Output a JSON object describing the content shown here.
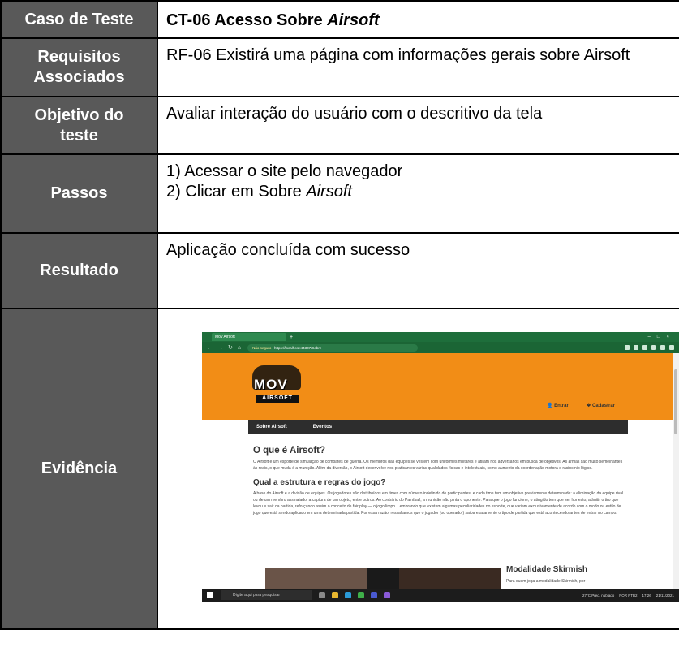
{
  "table": {
    "rows": {
      "caso": {
        "label": "Caso de Teste",
        "value_prefix": "CT-06 Acesso Sobre ",
        "value_italic": "Airsoft"
      },
      "requisitos": {
        "label_line1": "Requisitos",
        "label_line2": "Associados",
        "value": "RF-06 Existirá uma página com informações gerais sobre Airsoft"
      },
      "objetivo": {
        "label_line1": "Objetivo do",
        "label_line2": "teste",
        "value": "Avaliar interação do usuário com o descritivo da tela"
      },
      "passos": {
        "label": "Passos",
        "step1": "1) Acessar o site pelo navegador",
        "step2_prefix": "2) Clicar em Sobre ",
        "step2_italic": "Airsoft"
      },
      "resultado": {
        "label": "Resultado",
        "value": "Aplicação concluída com sucesso"
      },
      "evidencia": {
        "label": "Evidência"
      }
    }
  },
  "screenshot": {
    "tab_title": "Mov Airsoft",
    "url_warning": "Não seguro",
    "url": "https://localhost:44337/Sobre",
    "logo_text": "MOV",
    "logo_sub": "AIRSOFT",
    "entrar": "Entrar",
    "cadastrar": "Cadastrar",
    "menu": [
      "Sobre Airsoft",
      "Eventos"
    ],
    "h1": "O que é Airsoft?",
    "p1": "O Airsoft é um esporte de simulação de combates de guerra. Os membros das equipes se vestem com uniformes militares e atiram nos adversários em busca de objetivos. As armas são muito semelhantes às reais, o que muda é a munição. Além da diversão, o Airsoft desenvolve nos praticantes várias qualidades físicas e intelectuais, como aumento da coordenação motora e raciocínio lógico.",
    "h2": "Qual a estrutura e regras do jogo?",
    "p2": "A base do Airsoft é a divisão de equipes. Os jogadores são distribuídos em times com número indefinido de participantes, e cada time tem um objetivo previamente determinado: a eliminação da equipe rival ou de um membro assinalado, a captura de um objeto, entre outros. Ao contrário do Paintball, a munição não pinta o oponente. Para que o jogo funcione, o atingido tem que ser honesto, admitir o tiro que levou e sair da partida, reforçando assim o conceito de fair play — o jogo limpo. Lembrando que existem algumas peculiaridades no esporte, que variam exclusivamente de acordo com o modo ou estilo de jogo que está sendo aplicado em uma determinada partida. Por essa razão, ressaltamos que o jogador (ou operador) saiba exatamente o tipo de partida que está acontecendo antes de entrar no campo.",
    "h3": "Modalidade Skirmish",
    "p3": "Para quem joga a modalidade Skirmish, por",
    "taskbar_search": "Digite aqui para pesquisar",
    "weather": "27°C Pred. nublado",
    "time": "17:26",
    "date": "21/11/2021",
    "lang": "POR PTB2"
  }
}
